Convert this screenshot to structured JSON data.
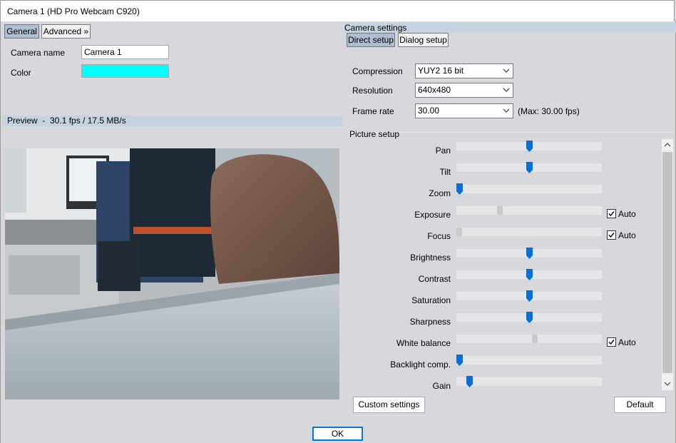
{
  "window": {
    "title": "Camera 1 (HD Pro Webcam C920)"
  },
  "left_tabs": [
    {
      "label": "General",
      "active": true
    },
    {
      "label": "Advanced »",
      "active": false
    }
  ],
  "general": {
    "camera_name_label": "Camera name",
    "camera_name_value": "Camera 1",
    "color_label": "Color",
    "color_value": "#00ffff"
  },
  "preview": {
    "label": "Preview  -  30.1 fps / 17.5 MB/s"
  },
  "camera_settings": {
    "title": "Camera settings",
    "tabs": [
      {
        "label": "Direct setup",
        "active": true
      },
      {
        "label": "Dialog setup",
        "active": false
      }
    ],
    "compression_label": "Compression",
    "compression_value": "YUY2 16 bit",
    "resolution_label": "Resolution",
    "resolution_value": "640x480",
    "framerate_label": "Frame rate",
    "framerate_value": "30.00",
    "framerate_max": "(Max: 30.00 fps)"
  },
  "picture_setup": {
    "title": "Picture setup",
    "auto_label": "Auto",
    "sliders": [
      {
        "label": "Pan",
        "value": 0.5,
        "enabled": true,
        "auto": null
      },
      {
        "label": "Tilt",
        "value": 0.5,
        "enabled": true,
        "auto": null
      },
      {
        "label": "Zoom",
        "value": 0.0,
        "enabled": true,
        "auto": null
      },
      {
        "label": "Exposure",
        "value": 0.29,
        "enabled": false,
        "auto": true
      },
      {
        "label": "Focus",
        "value": 0.0,
        "enabled": false,
        "auto": true
      },
      {
        "label": "Brightness",
        "value": 0.5,
        "enabled": true,
        "auto": null
      },
      {
        "label": "Contrast",
        "value": 0.5,
        "enabled": true,
        "auto": null
      },
      {
        "label": "Saturation",
        "value": 0.5,
        "enabled": true,
        "auto": null
      },
      {
        "label": "Sharpness",
        "value": 0.5,
        "enabled": true,
        "auto": null
      },
      {
        "label": "White balance",
        "value": 0.54,
        "enabled": false,
        "auto": true
      },
      {
        "label": "Backlight comp.",
        "value": 0.0,
        "enabled": true,
        "auto": null
      },
      {
        "label": "Gain",
        "value": 0.07,
        "enabled": true,
        "auto": null
      }
    ]
  },
  "buttons": {
    "custom": "Custom settings",
    "default": "Default",
    "ok": "OK"
  },
  "colors": {
    "accent": "#0a6fd1",
    "band": "#c5d3e0",
    "tab_active": "#aebdd0"
  }
}
